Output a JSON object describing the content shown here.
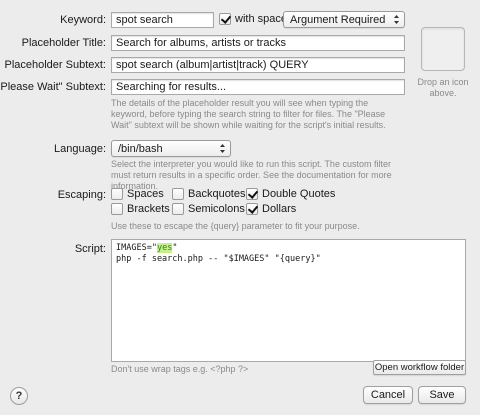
{
  "keyword": {
    "label": "Keyword:",
    "value": "spot search",
    "with_space_label": "with space",
    "with_space_checked": true,
    "argument_option": "Argument Required"
  },
  "placeholder_title": {
    "label": "Placeholder Title:",
    "value": "Search for albums, artists or tracks"
  },
  "placeholder_subtext": {
    "label": "Placeholder Subtext:",
    "value": "spot search (album|artist|track) QUERY"
  },
  "please_wait": {
    "label": "\"Please Wait\" Subtext:",
    "value": "Searching for results..."
  },
  "placeholder_help": "The details of the placeholder result you will see when typing the keyword, before typing the search string to filter for files. The \"Please Wait\" subtext will be shown while waiting for the script's initial results.",
  "icon_well": {
    "hint": "Drop an icon above."
  },
  "language": {
    "label": "Language:",
    "value": "/bin/bash",
    "help": "Select the interpreter you would like to run this script. The custom filter must return results in a specific order. See the documentation for more information."
  },
  "escaping": {
    "label": "Escaping:",
    "options": [
      {
        "label": "Spaces",
        "checked": false
      },
      {
        "label": "Backquotes",
        "checked": false
      },
      {
        "label": "Double Quotes",
        "checked": true
      },
      {
        "label": "Brackets",
        "checked": false
      },
      {
        "label": "Semicolons",
        "checked": false
      },
      {
        "label": "Dollars",
        "checked": true
      }
    ],
    "help": "Use these to escape the {query} parameter to fit your purpose."
  },
  "script": {
    "label": "Script:",
    "line1_pre": "IMAGES=\"",
    "line1_hl": "yes",
    "line1_post": "\"",
    "line2": "php -f search.php -- \"$IMAGES\" \"{query}\"",
    "footer_hint": "Don't use wrap tags e.g. <?php ?>",
    "open_folder_label": "Open workflow folder"
  },
  "footer": {
    "help_label": "?",
    "cancel_label": "Cancel",
    "save_label": "Save"
  }
}
